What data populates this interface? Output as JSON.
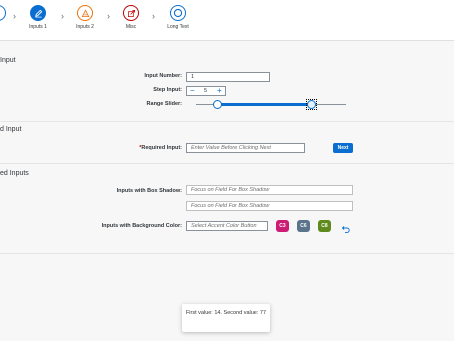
{
  "wizard": {
    "steps": [
      {
        "label": "Inputs 1"
      },
      {
        "label": "Inputs 2"
      },
      {
        "label": "Misc"
      },
      {
        "label": "Long Text"
      }
    ],
    "colors": {
      "active": "#0a6ed1",
      "warning": "#e9730c",
      "error": "#bb0000"
    }
  },
  "section1": {
    "title": "Input",
    "input_number_label": "Input Number:",
    "input_number_value": "1",
    "step_input_label": "Step Input:",
    "step_value": "5",
    "range_slider_label": "Range Slider:",
    "range": {
      "min": 0,
      "max": 100,
      "low": 14,
      "high": 77
    }
  },
  "section2": {
    "title": "d Input",
    "required_label": "Required Input:",
    "required_placeholder": "Enter Value Before Clicking Next",
    "next_label": "Next"
  },
  "section3": {
    "title": "ed Inputs",
    "shadow_label": "Inputs with Box Shadow:",
    "shadow_placeholder_1": "Focus on Field For Box Shadow",
    "shadow_placeholder_2": "Focus on Field For Box Shadow",
    "bg_label": "Inputs with Background Color:",
    "bg_placeholder": "Select Accent Color Button",
    "swatches": [
      {
        "label": "C3",
        "color": "#cc1c74"
      },
      {
        "label": "C6",
        "color": "#5b738b"
      },
      {
        "label": "C8",
        "color": "#5f8b1e"
      }
    ]
  },
  "toast": {
    "message": "First value: 14. Second value: 77"
  }
}
